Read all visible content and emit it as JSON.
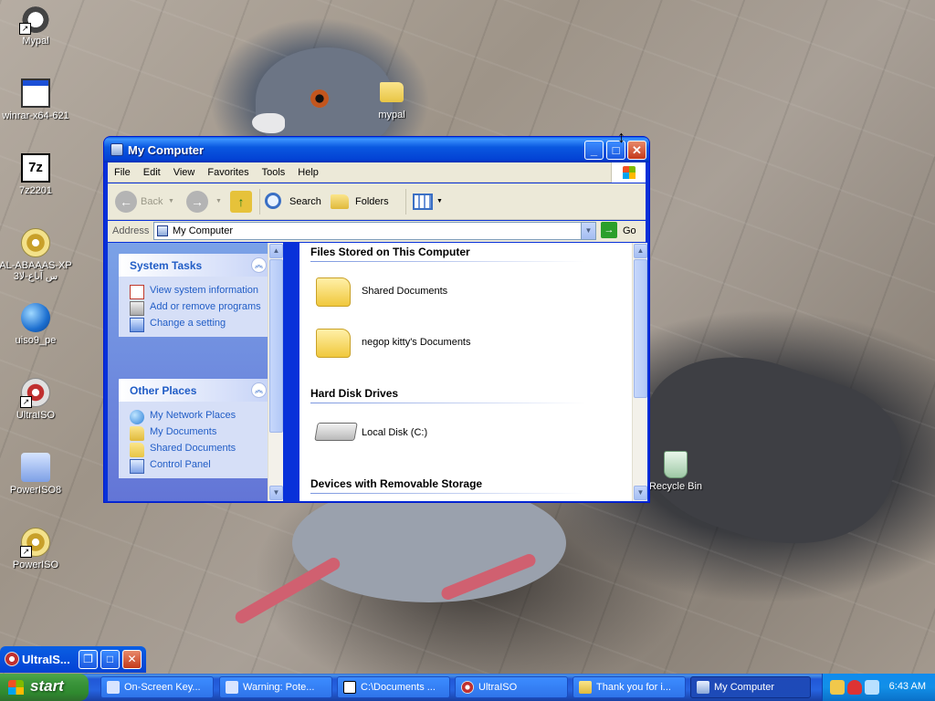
{
  "desktop": {
    "icons": [
      {
        "label": "Mypal",
        "icon": "raccoon-icon"
      },
      {
        "label": "winrar-x64-621",
        "icon": "window-icon"
      },
      {
        "label": "7z2201",
        "icon": "7z-icon"
      },
      {
        "label": "AL-ABAAAS-XP 3س آباع-لا",
        "icon": "cd-icon"
      },
      {
        "label": "uiso9_pe",
        "icon": "globe-icon"
      },
      {
        "label": "UltraISO",
        "icon": "ultraiso-icon"
      },
      {
        "label": "PowerISO8",
        "icon": "installer-icon"
      },
      {
        "label": "PowerISO",
        "icon": "poweriso-icon"
      },
      {
        "label": "mypal",
        "icon": "folder-icon"
      },
      {
        "label": "Recycle Bin",
        "icon": "recycle-bin-icon"
      }
    ]
  },
  "window": {
    "title": "My Computer",
    "menu": [
      "File",
      "Edit",
      "View",
      "Favorites",
      "Tools",
      "Help"
    ],
    "toolbar": {
      "back": "Back",
      "search": "Search",
      "folders": "Folders"
    },
    "address": {
      "label": "Address",
      "value": "My Computer",
      "go": "Go"
    },
    "system_tasks": {
      "title": "System Tasks",
      "items": [
        "View system information",
        "Add or remove programs",
        "Change a setting"
      ]
    },
    "other_places": {
      "title": "Other Places",
      "items": [
        "My Network Places",
        "My Documents",
        "Shared Documents",
        "Control Panel"
      ]
    },
    "groups": {
      "files_stored": "Files Stored on This Computer",
      "hard_disks": "Hard Disk Drives",
      "removable": "Devices with Removable Storage"
    },
    "files": [
      "Shared Documents",
      "negop kitty's Documents"
    ],
    "disks": [
      "Local Disk (C:)"
    ]
  },
  "minimized_window": {
    "title": "UltraIS..."
  },
  "taskbar": {
    "start": "start",
    "tasks": [
      {
        "label": "On-Screen Key..."
      },
      {
        "label": "Warning: Pote..."
      },
      {
        "label": "C:\\Documents ..."
      },
      {
        "label": "UltraISO"
      },
      {
        "label": "Thank you for i..."
      },
      {
        "label": "My Computer"
      }
    ],
    "clock": "6:43 AM"
  },
  "colors": {
    "xp_blue": "#0a5fe3",
    "start_green": "#3c963c",
    "link_blue": "#215dc6"
  }
}
